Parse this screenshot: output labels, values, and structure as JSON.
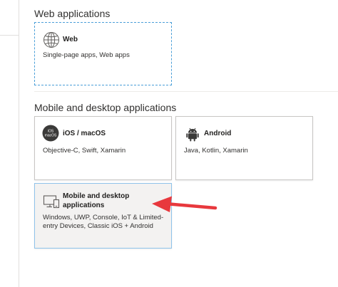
{
  "sections": {
    "web": {
      "title": "Web applications",
      "cards": {
        "web": {
          "title": "Web",
          "description": "Single-page apps, Web apps",
          "icon": "globe-icon"
        }
      }
    },
    "mobile": {
      "title": "Mobile and desktop applications",
      "cards": {
        "ios": {
          "title": "iOS / macOS",
          "description": "Objective-C, Swift, Xamarin",
          "icon": "ios-macos-icon",
          "icon_text_top": "iOS",
          "icon_text_bottom": "macOS"
        },
        "android": {
          "title": "Android",
          "description": "Java, Kotlin, Xamarin",
          "icon": "android-icon"
        },
        "desktop": {
          "title_line1": "Mobile and desktop",
          "title_line2": "applications",
          "description_line1": "Windows, UWP, Console, IoT & Limited-",
          "description_line2": "entry Devices, Classic iOS + Android",
          "icon": "desktop-monitor-icon"
        }
      }
    }
  },
  "colors": {
    "annotation_arrow": "#e8383d",
    "focus_border": "#4a9fd8",
    "selected_background": "#f3f2f1"
  }
}
